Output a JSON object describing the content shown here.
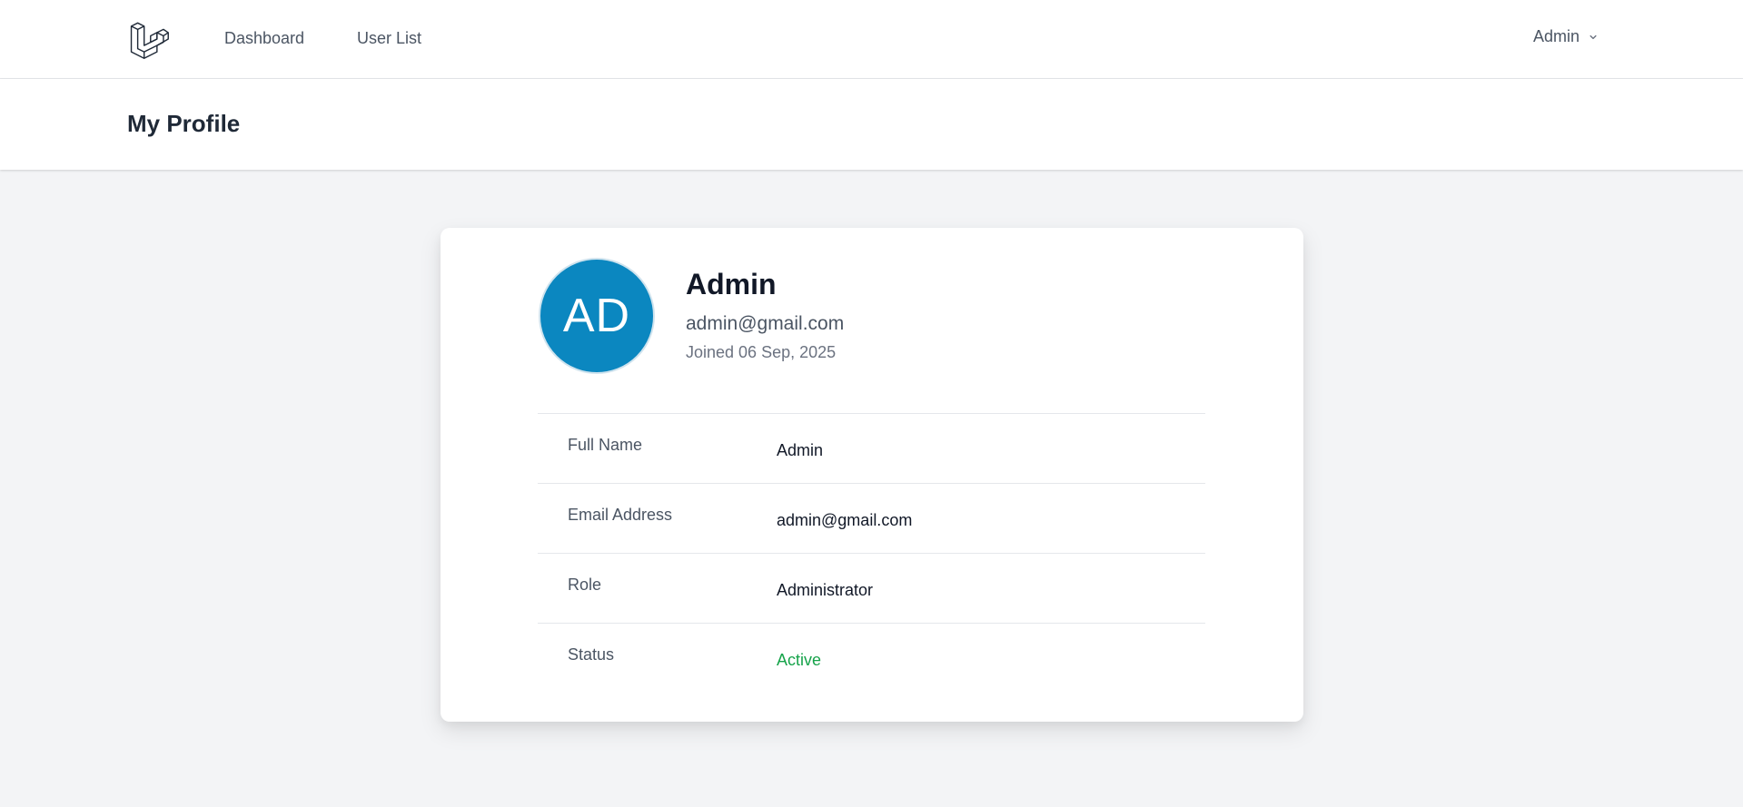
{
  "nav": {
    "logo_icon": "laravel-logo-icon",
    "links": [
      "Dashboard",
      "User List"
    ],
    "user_menu_label": "Admin",
    "user_menu_icon": "chevron-down-icon"
  },
  "header": {
    "title": "My Profile"
  },
  "profile": {
    "initials": "AD",
    "avatar_color": "#0b87c0",
    "name": "Admin",
    "email": "admin@gmail.com",
    "joined": "Joined 06 Sep, 2025",
    "details": [
      {
        "label": "Full Name",
        "value": "Admin"
      },
      {
        "label": "Email Address",
        "value": "admin@gmail.com"
      },
      {
        "label": "Role",
        "value": "Administrator"
      },
      {
        "label": "Status",
        "value": "Active",
        "value_color": "#16a34a"
      }
    ]
  }
}
